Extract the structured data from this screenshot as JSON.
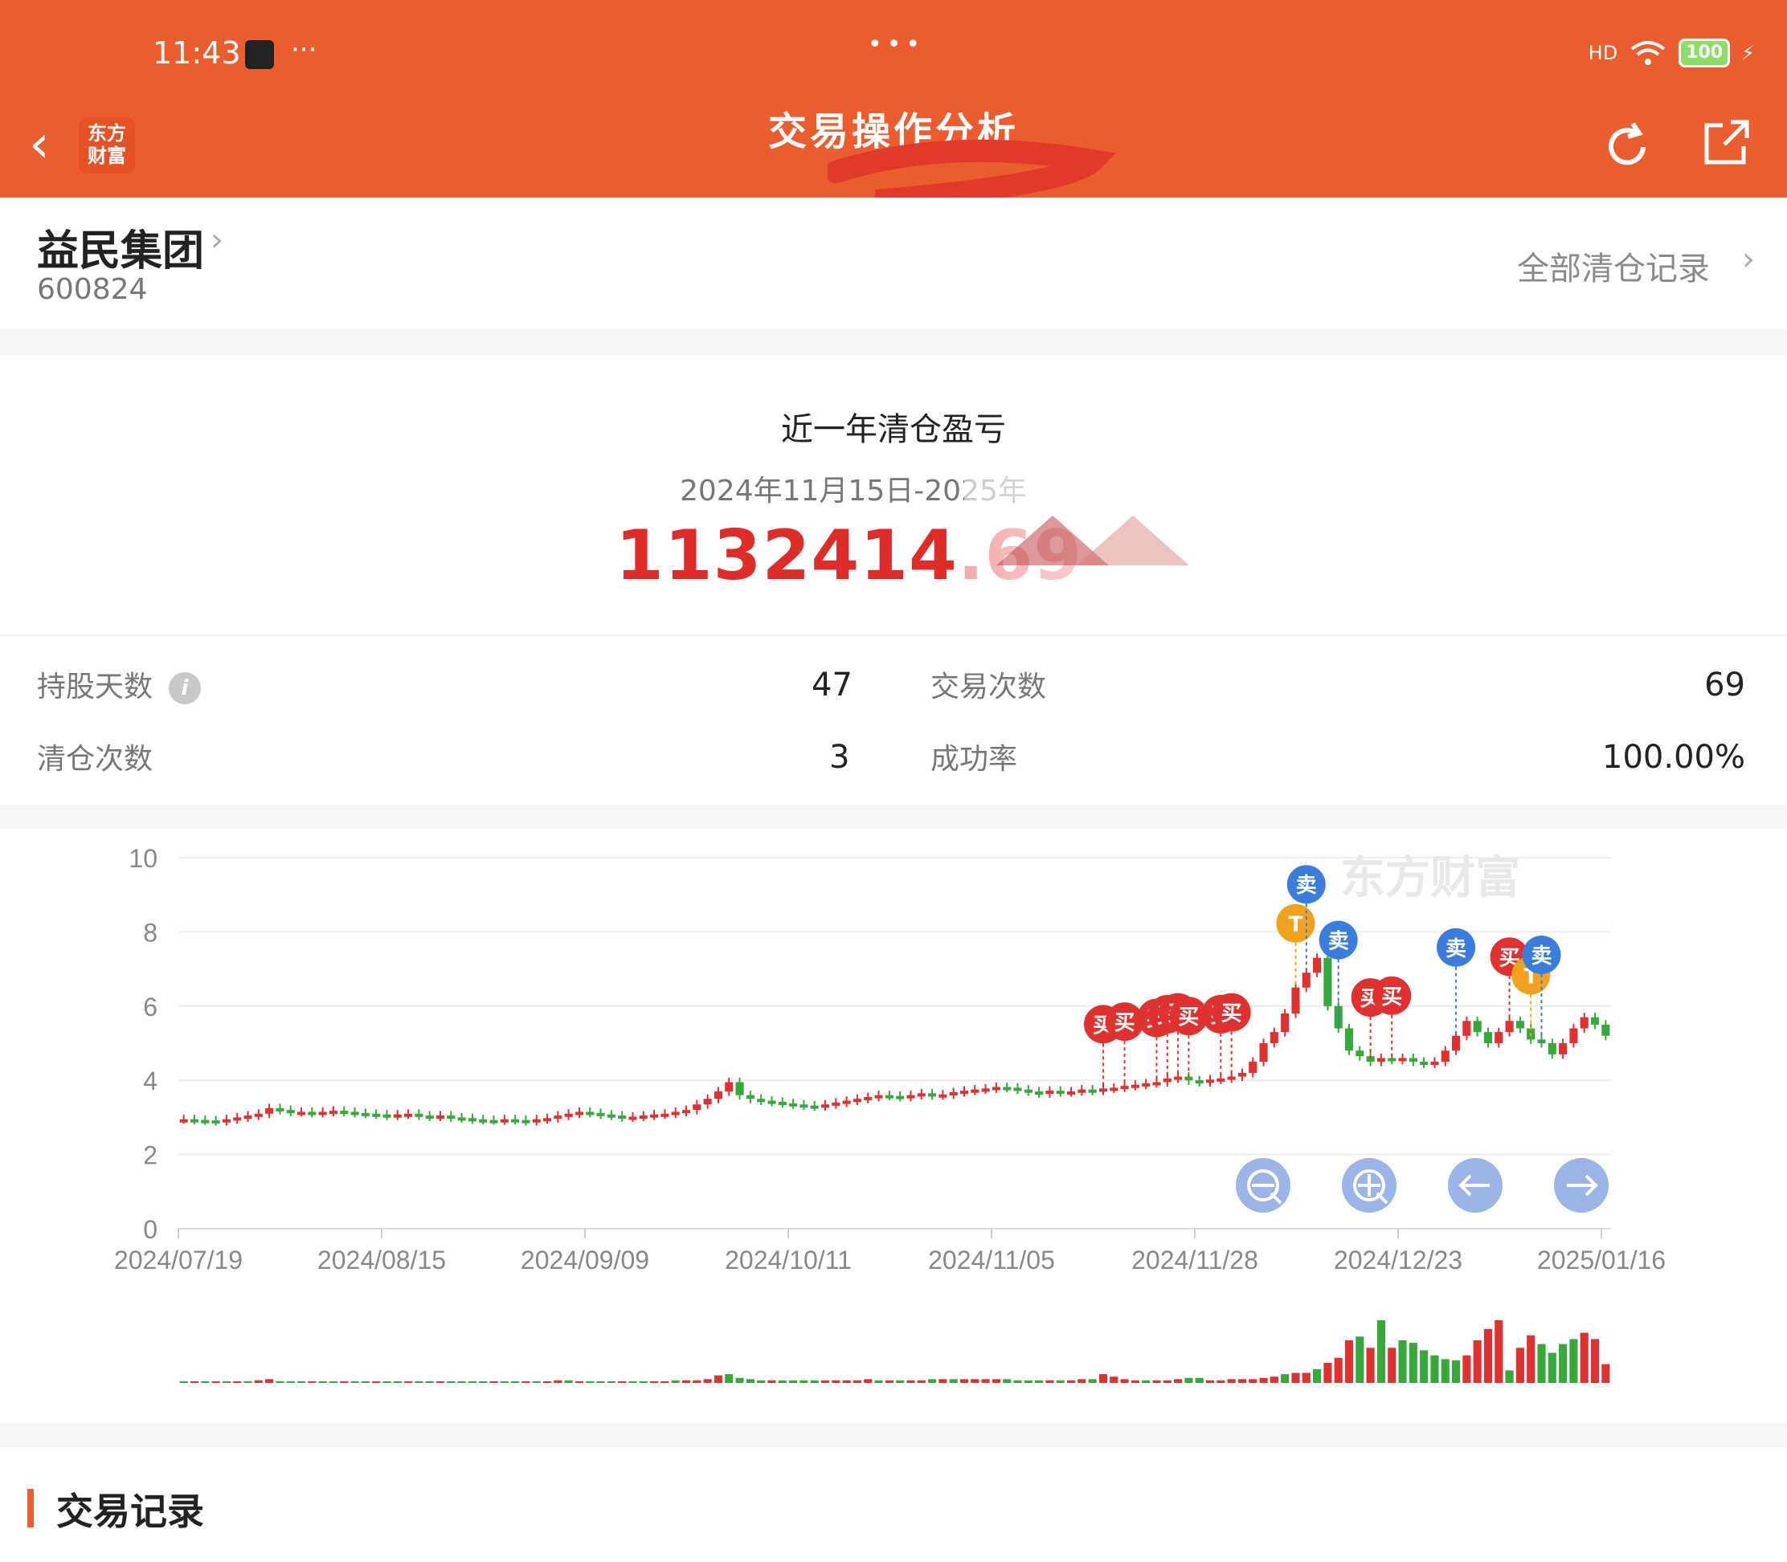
{
  "status": {
    "time": "11:43",
    "more": "···",
    "battery": "100",
    "signal": "HD"
  },
  "header": {
    "title": "交易操作分析",
    "logo_line1": "东方",
    "logo_line2": "财富",
    "handle": "•••"
  },
  "stock": {
    "name": "益民集团",
    "code": "600824",
    "clear_link": "全部清仓记录"
  },
  "summary": {
    "title": "近一年清仓盈亏",
    "range": "2024年11月15日-2025年",
    "value": "1132414.69"
  },
  "stats": [
    {
      "label": "持股天数",
      "value": "47"
    },
    {
      "label": "交易次数",
      "value": "69"
    },
    {
      "label": "清仓次数",
      "value": "3"
    },
    {
      "label": "成功率",
      "value": "100.00%"
    }
  ],
  "chart_data": {
    "type": "candlestick",
    "watermark": "东方财富",
    "ylim": [
      0,
      10
    ],
    "yticks": [
      "0",
      "2",
      "4",
      "6",
      "8",
      "10"
    ],
    "xticks": [
      "2024/07/19",
      "2024/08/15",
      "2024/09/09",
      "2024/10/11",
      "2024/11/05",
      "2024/11/28",
      "2024/12/23",
      "2025/01/16"
    ],
    "up_color": "#e03131",
    "down_color": "#37a83b",
    "close_series": [
      2.95,
      2.93,
      2.92,
      2.9,
      2.95,
      3.0,
      3.05,
      3.1,
      3.25,
      3.2,
      3.15,
      3.15,
      3.12,
      3.15,
      3.18,
      3.15,
      3.12,
      3.1,
      3.08,
      3.05,
      3.08,
      3.1,
      3.05,
      3.02,
      3.05,
      3.0,
      2.98,
      2.95,
      2.93,
      2.92,
      2.95,
      2.93,
      2.9,
      2.95,
      2.98,
      3.05,
      3.1,
      3.15,
      3.12,
      3.08,
      3.05,
      3.0,
      3.02,
      3.05,
      3.08,
      3.1,
      3.15,
      3.2,
      3.35,
      3.5,
      3.7,
      3.95,
      3.6,
      3.5,
      3.45,
      3.42,
      3.38,
      3.35,
      3.32,
      3.3,
      3.35,
      3.4,
      3.45,
      3.5,
      3.55,
      3.6,
      3.58,
      3.55,
      3.6,
      3.65,
      3.6,
      3.62,
      3.68,
      3.72,
      3.75,
      3.78,
      3.82,
      3.8,
      3.75,
      3.7,
      3.65,
      3.72,
      3.68,
      3.7,
      3.75,
      3.72,
      3.78,
      3.8,
      3.85,
      3.88,
      3.92,
      3.95,
      4.05,
      4.1,
      4.0,
      3.95,
      4.02,
      4.05,
      4.1,
      4.2,
      4.5,
      5.0,
      5.3,
      5.8,
      6.5,
      6.9,
      7.3,
      6.0,
      5.4,
      4.8,
      4.65,
      4.5,
      4.6,
      4.55,
      4.6,
      4.5,
      4.45,
      4.5,
      4.8,
      5.2,
      5.6,
      5.3,
      5.0,
      5.3,
      5.6,
      5.4,
      5.1,
      5.0,
      4.7,
      5.0,
      5.4,
      5.7,
      5.5,
      5.2
    ],
    "volume_series": [
      1,
      1,
      1,
      1,
      1,
      1,
      1,
      2,
      3,
      1,
      1,
      1,
      1,
      1,
      1,
      1,
      1,
      1,
      1,
      1,
      1,
      1,
      1,
      1,
      1,
      1,
      1,
      1,
      1,
      1,
      1,
      1,
      1,
      1,
      1,
      2,
      2,
      1,
      1,
      1,
      1,
      1,
      1,
      1,
      1,
      1,
      2,
      2,
      2,
      3,
      6,
      7,
      4,
      3,
      2,
      2,
      2,
      2,
      2,
      2,
      2,
      2,
      2,
      2,
      3,
      2,
      2,
      2,
      2,
      2,
      3,
      3,
      3,
      3,
      3,
      3,
      3,
      3,
      2,
      2,
      2,
      2,
      2,
      2,
      3,
      3,
      7,
      5,
      3,
      2,
      2,
      2,
      2,
      3,
      4,
      4,
      2,
      2,
      3,
      3,
      3,
      4,
      5,
      7,
      8,
      8,
      11,
      16,
      20,
      34,
      37,
      28,
      50,
      28,
      34,
      32,
      26,
      22,
      19,
      18,
      22,
      34,
      43,
      50,
      10,
      28,
      38,
      31,
      24,
      31,
      35,
      40,
      35,
      15
    ],
    "volume_up_flags": [
      0,
      1,
      0,
      1,
      0,
      1,
      0,
      1,
      1,
      0,
      0,
      0,
      1,
      0,
      0,
      1,
      0,
      0,
      1,
      0,
      0,
      1,
      0,
      0,
      1,
      0,
      0,
      0,
      0,
      1,
      0,
      0,
      1,
      0,
      1,
      1,
      0,
      1,
      0,
      0,
      0,
      1,
      0,
      0,
      1,
      1,
      0,
      1,
      1,
      1,
      1,
      0,
      0,
      0,
      0,
      1,
      0,
      0,
      0,
      0,
      1,
      1,
      1,
      1,
      1,
      0,
      1,
      0,
      1,
      1,
      0,
      1,
      0,
      1,
      1,
      1,
      1,
      0,
      0,
      0,
      0,
      1,
      0,
      1,
      1,
      0,
      1,
      1,
      1,
      1,
      0,
      1,
      1,
      1,
      0,
      0,
      1,
      1,
      1,
      1,
      1,
      1,
      1,
      0,
      1,
      1,
      0,
      1,
      1,
      1,
      0,
      1,
      0,
      1,
      0,
      0,
      0,
      0,
      0,
      0,
      1,
      1,
      1,
      1,
      0,
      1,
      1,
      0,
      0,
      0,
      0,
      1,
      1,
      1,
      0,
      0
    ],
    "markers": [
      {
        "label": "买",
        "type": "buy",
        "idx": 86
      },
      {
        "label": "买",
        "type": "buy",
        "idx": 88
      },
      {
        "label": "买",
        "type": "buy",
        "idx": 91
      },
      {
        "label": "买",
        "type": "buy",
        "idx": 92
      },
      {
        "label": "买",
        "type": "buy",
        "idx": 93
      },
      {
        "label": "买",
        "type": "buy",
        "idx": 94
      },
      {
        "label": "买",
        "type": "buy",
        "idx": 97
      },
      {
        "label": "买",
        "type": "buy",
        "idx": 98
      },
      {
        "label": "T",
        "type": "t",
        "idx": 104
      },
      {
        "label": "卖",
        "type": "sell",
        "idx": 105
      },
      {
        "label": "卖",
        "type": "sell",
        "idx": 108
      },
      {
        "label": "买",
        "type": "buy",
        "idx": 111
      },
      {
        "label": "买",
        "type": "buy",
        "idx": 113
      },
      {
        "label": "卖",
        "type": "sell",
        "idx": 119
      },
      {
        "label": "买",
        "type": "buy",
        "idx": 124
      },
      {
        "label": "T",
        "type": "t",
        "idx": 126
      },
      {
        "label": "卖",
        "type": "sell",
        "idx": 127
      }
    ],
    "controls": [
      "zoom-out",
      "zoom-in",
      "pan-left",
      "pan-right"
    ]
  },
  "records": {
    "title": "交易记录"
  },
  "colors": {
    "brand": "#eb5d2e",
    "profit": "#e02b2b",
    "sell_marker": "#3b7ddd",
    "t_marker": "#f0a21f",
    "control_fill": "#9db5e6"
  }
}
